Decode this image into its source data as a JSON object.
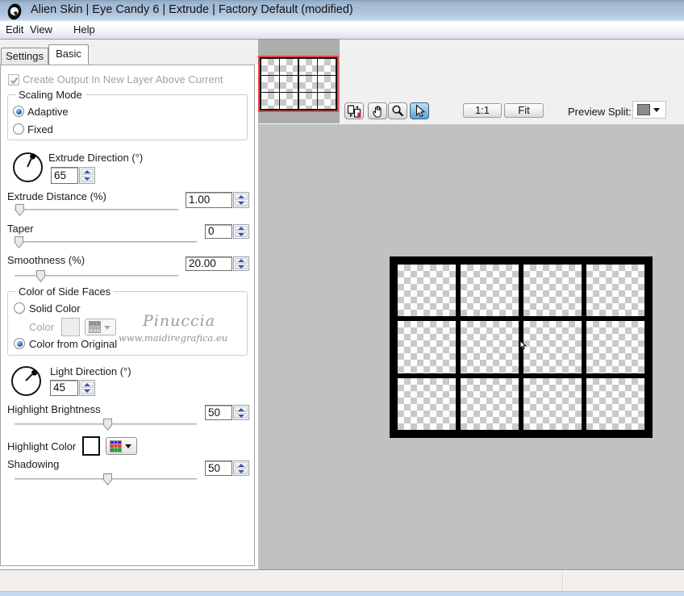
{
  "window": {
    "title": "Alien Skin | Eye Candy 6 | Extrude | Factory Default (modified)"
  },
  "menubar": {
    "items": [
      "Edit",
      "View",
      "Help"
    ]
  },
  "tabs": [
    {
      "label": "Settings",
      "active": false
    },
    {
      "label": "Basic",
      "active": true
    }
  ],
  "panel": {
    "create_output": {
      "label": "Create Output In New Layer Above Current",
      "checked": true,
      "enabled": false
    },
    "scaling_mode": {
      "title": "Scaling Mode",
      "options": [
        {
          "label": "Adaptive",
          "selected": true
        },
        {
          "label": "Fixed",
          "selected": false
        }
      ]
    },
    "extrude_direction": {
      "label": "Extrude Direction (°)",
      "value": "65",
      "angle_deg": 65
    },
    "extrude_distance": {
      "label": "Extrude Distance (%)",
      "value": "1.00",
      "slider_frac": 0.004
    },
    "taper": {
      "label": "Taper",
      "value": "0",
      "slider_frac": 0.0
    },
    "smoothness": {
      "label": "Smoothness (%)",
      "value": "20.00",
      "slider_frac": 0.14
    },
    "color_of_side_faces": {
      "title": "Color of Side Faces",
      "options": [
        {
          "label": "Solid Color",
          "selected": false
        },
        {
          "label": "Color from Original",
          "selected": true
        }
      ],
      "color_label": "Color",
      "color_swatch": "#ededed"
    },
    "light_direction": {
      "label": "Light Direction (°)",
      "value": "45",
      "angle_deg": 45
    },
    "highlight_brightness": {
      "label": "Highlight Brightness",
      "value": "50",
      "slider_frac": 0.51
    },
    "highlight_color": {
      "label": "Highlight Color",
      "swatch": "#ffffff"
    },
    "shadowing": {
      "label": "Shadowing",
      "value": "50",
      "slider_frac": 0.51
    },
    "watermark": {
      "line1": "Pinuccia",
      "line2": "www.maidiregrafica.eu"
    }
  },
  "toolbar": {
    "tools": [
      {
        "name": "compare-preview",
        "active": false
      },
      {
        "name": "pan",
        "active": false
      },
      {
        "name": "zoom",
        "active": false
      },
      {
        "name": "select",
        "active": true
      }
    ],
    "one_to_one_label": "1:1",
    "fit_label": "Fit",
    "preview_split_label": "Preview Split:",
    "preview_split_swatch": "#8c8c8c"
  },
  "preview": {
    "grid_cols": 4,
    "grid_rows": 3,
    "checker_light": "#fdfdfd",
    "checker_dark": "#c9c9c9"
  },
  "colors": {
    "titlebar_top": "#93abc6",
    "titlebar_bottom": "#cfe0f2",
    "preview_bg": "#c1c1c1",
    "thumb_border": "#ef4440",
    "selected_tool_bg": "#5e9fce",
    "statusbar_bg": "#f3eeeb",
    "bottombar_bg": "#c7dcf2"
  }
}
